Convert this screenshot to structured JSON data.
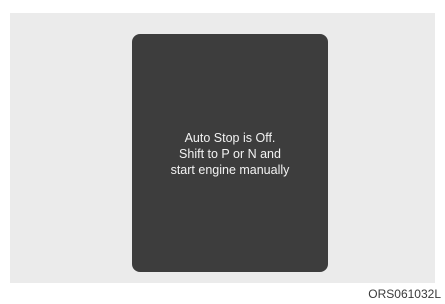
{
  "display": {
    "message_lines": [
      "Auto Stop is Off.",
      "Shift to P or N and",
      "start engine manually"
    ]
  },
  "figure": {
    "code": "ORS061032L"
  },
  "colors": {
    "background": "#ebebeb",
    "display_panel": "#3d3d3d",
    "display_text": "#f2f2f2"
  }
}
